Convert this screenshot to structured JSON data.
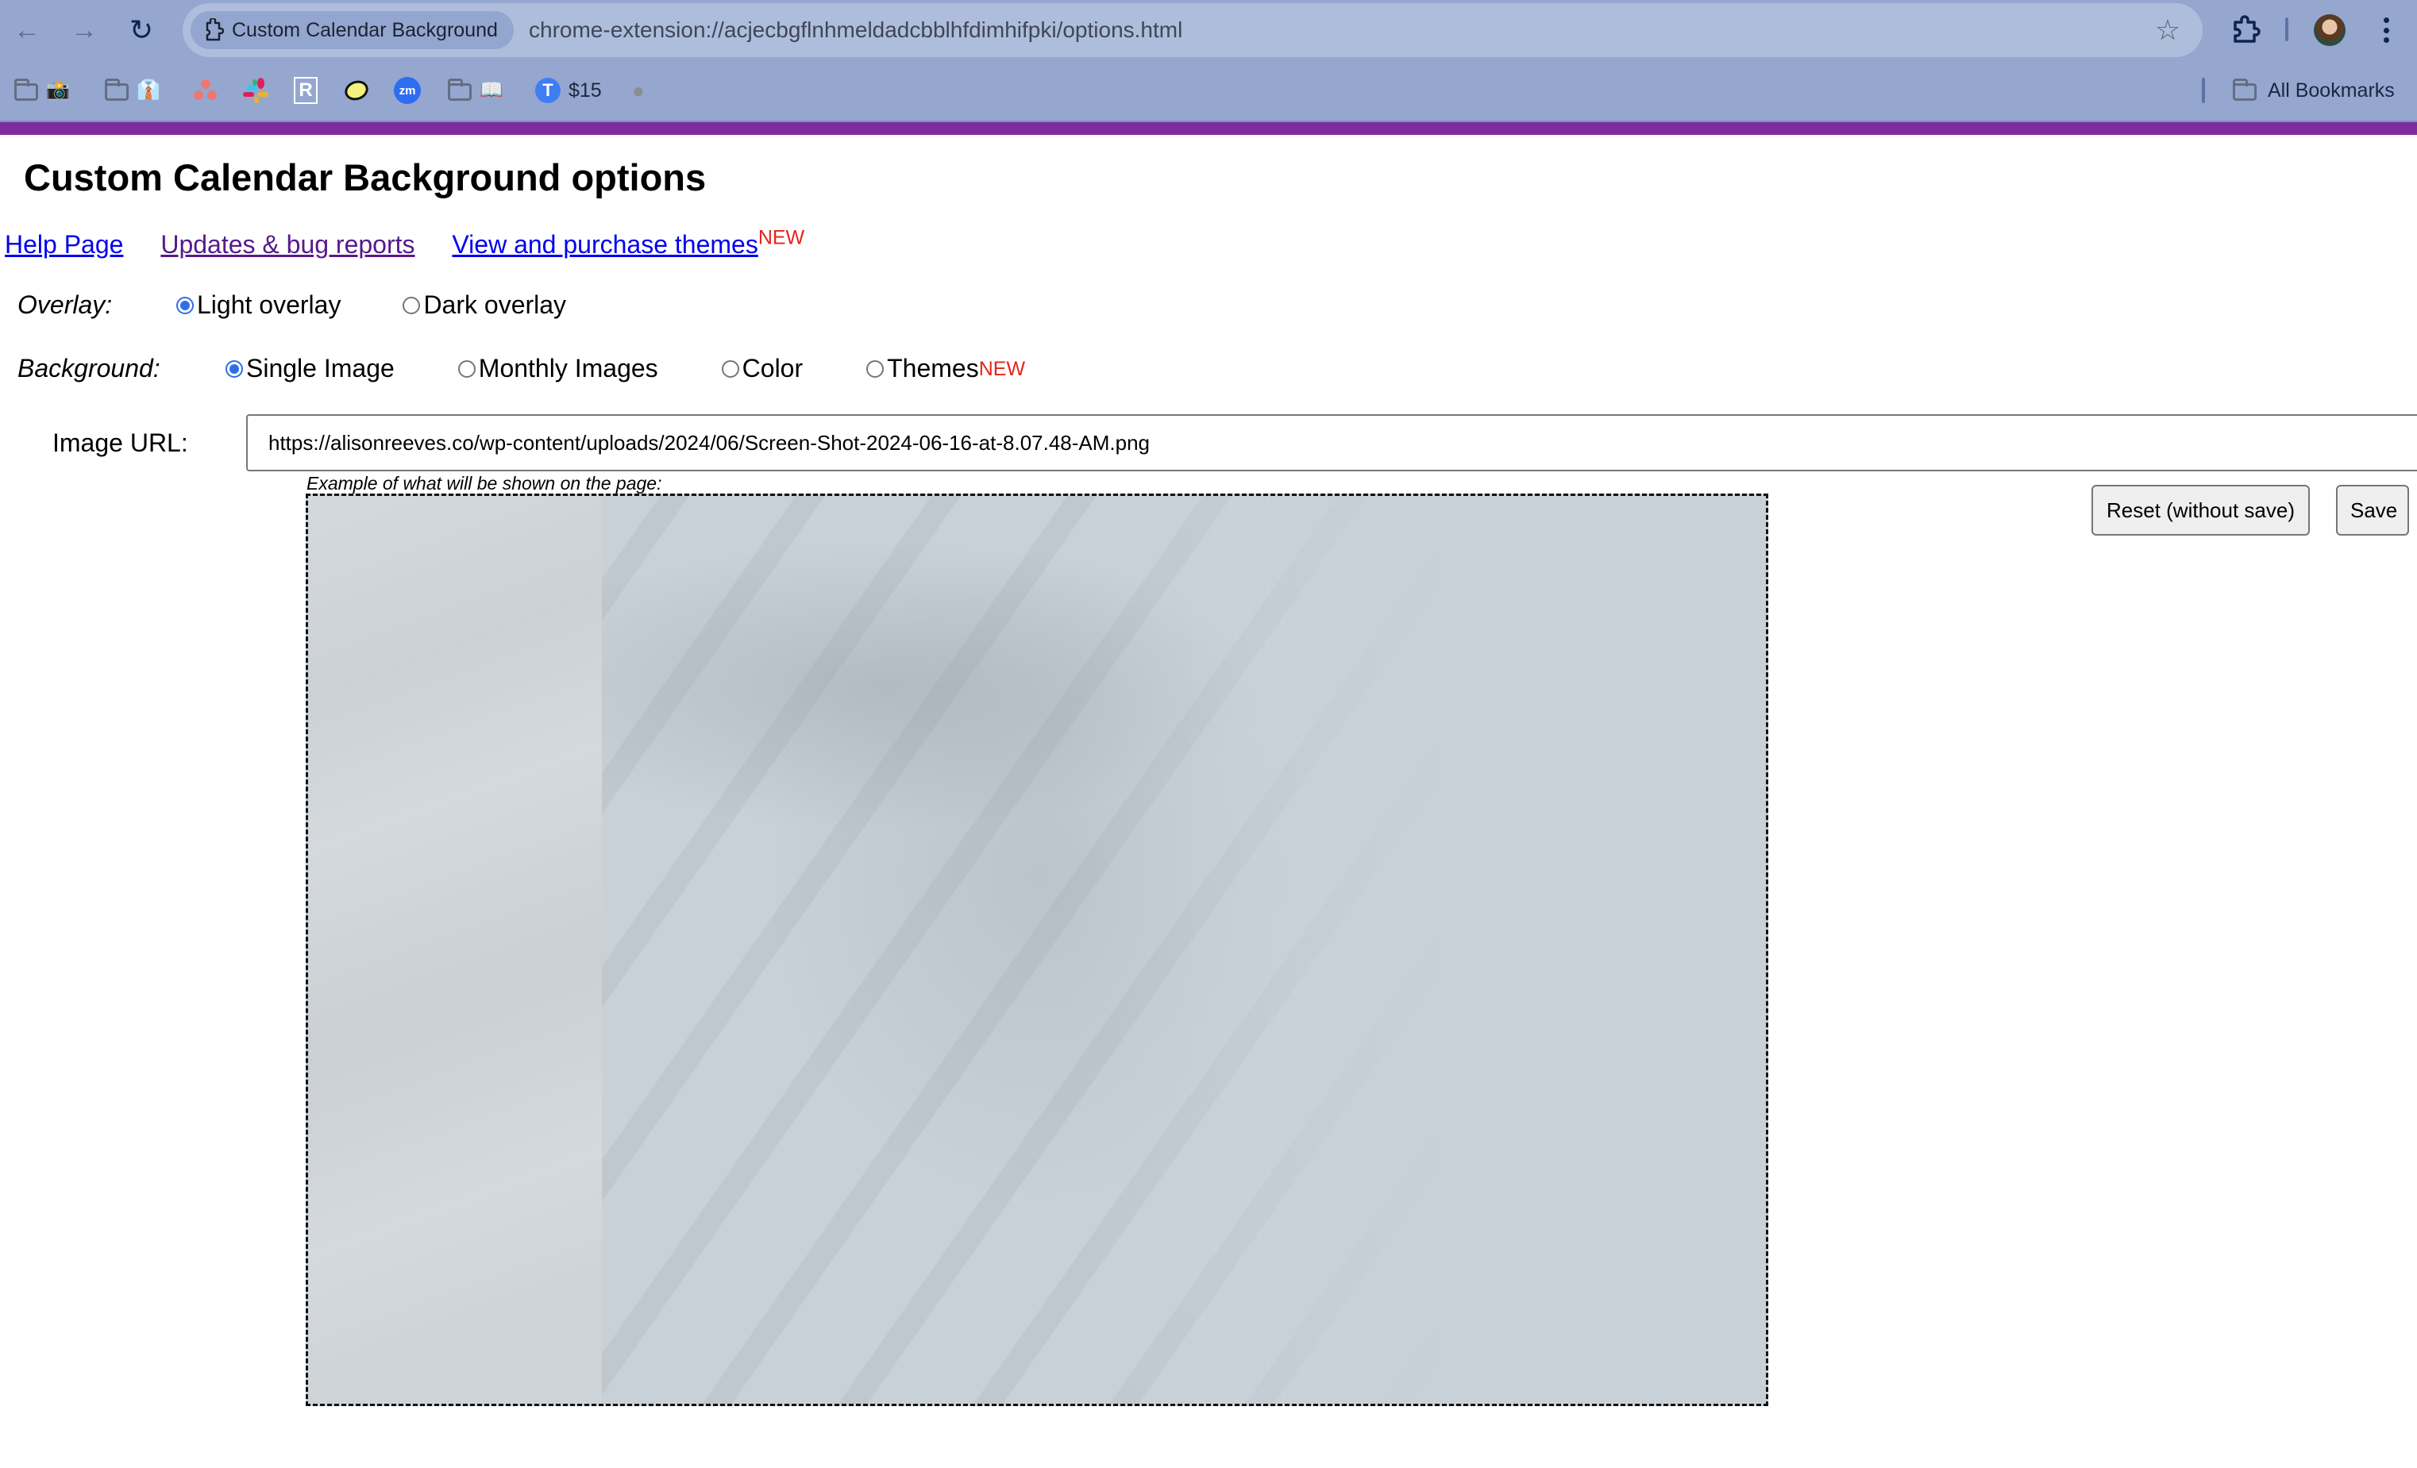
{
  "browser": {
    "tab_chip_label": "Custom Calendar Background",
    "address_url": "chrome-extension://acjecbgflnhmeldadcbblhfdimhifpki/options.html",
    "nav": {
      "back_icon": "←",
      "forward_icon": "→",
      "reload_icon": "↻",
      "star_icon": "☆"
    },
    "bookmarks": [
      {
        "type": "folder",
        "emoji": "📸"
      },
      {
        "type": "folder",
        "emoji": "👔"
      },
      {
        "type": "site",
        "icon": "asana-icon"
      },
      {
        "type": "site",
        "icon": "slack-icon"
      },
      {
        "type": "site",
        "icon": "r-icon",
        "glyph": "R"
      },
      {
        "type": "site",
        "icon": "lemon-icon"
      },
      {
        "type": "site",
        "icon": "zoom-icon",
        "glyph": "zm"
      },
      {
        "type": "folder",
        "emoji": "📖"
      },
      {
        "type": "site",
        "icon": "t-icon",
        "glyph": "T",
        "label": "$15"
      },
      {
        "type": "site",
        "icon": "apple-icon",
        "glyph": ""
      }
    ],
    "all_bookmarks_label": "All Bookmarks"
  },
  "page": {
    "title": "Custom Calendar Background options",
    "links": {
      "help": "Help Page",
      "updates": "Updates & bug reports",
      "themes": "View and purchase themes",
      "themes_badge": "NEW"
    },
    "overlay": {
      "label": "Overlay:",
      "options": [
        {
          "label": "Light overlay",
          "checked": true
        },
        {
          "label": "Dark overlay",
          "checked": false
        }
      ]
    },
    "background": {
      "label": "Background:",
      "options": [
        {
          "label": "Single Image",
          "checked": true
        },
        {
          "label": "Monthly Images",
          "checked": false
        },
        {
          "label": "Color",
          "checked": false
        },
        {
          "label": "Themes",
          "checked": false,
          "badge": "NEW"
        }
      ]
    },
    "image_url": {
      "label": "Image URL:",
      "value": "https://alisonreeves.co/wp-content/uploads/2024/06/Screen-Shot-2024-06-16-at-8.07.48-AM.png"
    },
    "preview_caption": "Example of what will be shown on the page:",
    "buttons": {
      "reset": "Reset (without save)",
      "save": "Save"
    }
  },
  "colors": {
    "chrome_bg": "#95a7cf",
    "omnibox_bg": "#aebddb",
    "accent_bar": "#7f2b9e",
    "link": "#0000ee",
    "visited_link": "#551a8b",
    "new_badge": "#e5231b",
    "radio_checked": "#2f6ee8"
  }
}
